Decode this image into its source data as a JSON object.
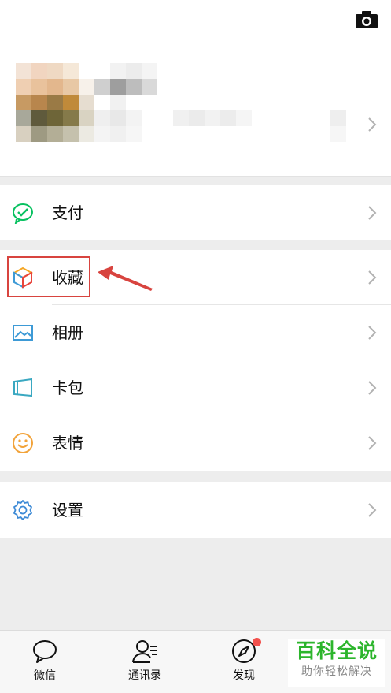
{
  "menu_groups": [
    {
      "items": [
        {
          "id": "pay",
          "label": "支付",
          "icon": "wechat-pay-icon",
          "color": "#07c160"
        }
      ]
    },
    {
      "items": [
        {
          "id": "favorites",
          "label": "收藏",
          "icon": "cube-icon",
          "color": "#f5a623"
        },
        {
          "id": "album",
          "label": "相册",
          "icon": "image-icon",
          "color": "#3d9ad6"
        },
        {
          "id": "card",
          "label": "卡包",
          "icon": "card-wallet-icon",
          "color": "#3aa8c1"
        },
        {
          "id": "stickers",
          "label": "表情",
          "icon": "smile-icon",
          "color": "#f2a33a"
        }
      ]
    },
    {
      "items": [
        {
          "id": "settings",
          "label": "设置",
          "icon": "gear-icon",
          "color": "#3d8ad6"
        }
      ]
    }
  ],
  "tabbar": {
    "tabs": [
      {
        "id": "chats",
        "label": "微信",
        "icon": "chat-bubble-icon"
      },
      {
        "id": "contacts",
        "label": "通讯录",
        "icon": "contacts-icon"
      },
      {
        "id": "discover",
        "label": "发现",
        "icon": "compass-icon",
        "badge_dot": true
      }
    ]
  },
  "watermark": {
    "title": "百科全说",
    "subtitle": "助你轻松解决"
  },
  "colors": {
    "highlight": "#d8443f",
    "badge": "#f2504c",
    "watermark_green": "#2cb52c"
  }
}
